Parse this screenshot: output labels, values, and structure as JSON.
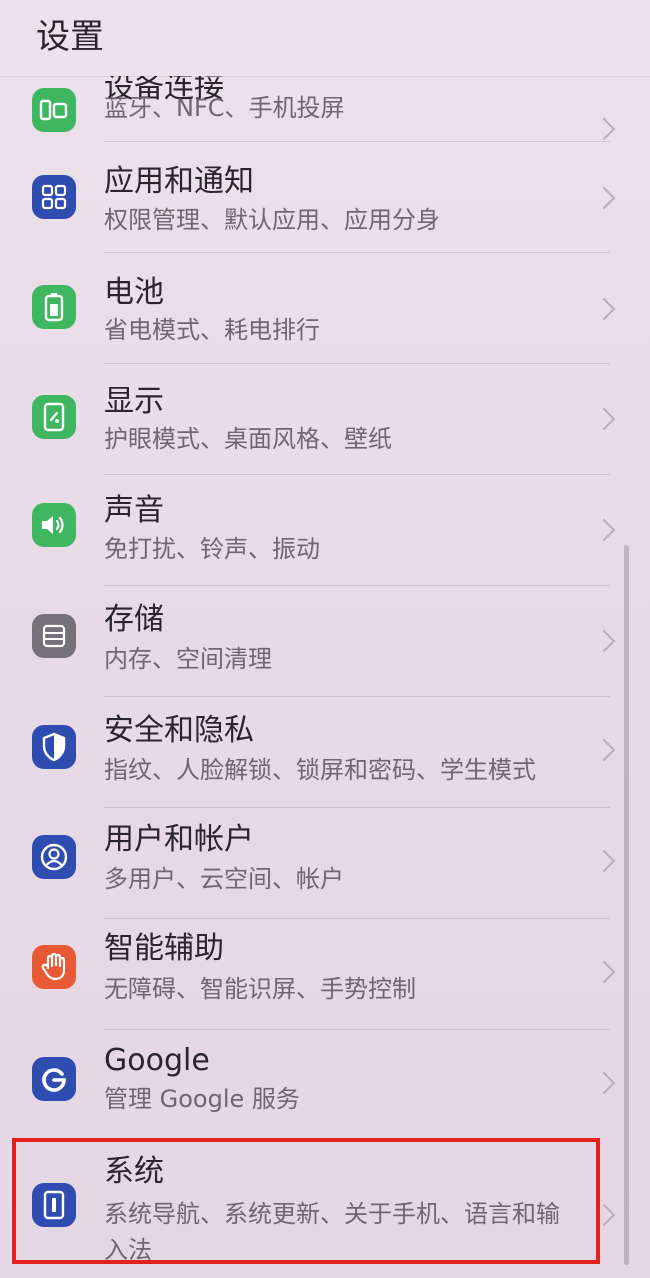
{
  "header": {
    "title": "设置"
  },
  "items": [
    {
      "key": "device-connection",
      "title": "设备连接",
      "subtitle": "蓝牙、NFC、手机投屏",
      "icon": "device-connection-icon",
      "icon_color": "#3fb660"
    },
    {
      "key": "apps",
      "title": "应用和通知",
      "subtitle": "权限管理、默认应用、应用分身",
      "icon": "apps-grid-icon",
      "icon_color": "#2f4db0"
    },
    {
      "key": "battery",
      "title": "电池",
      "subtitle": "省电模式、耗电排行",
      "icon": "battery-icon",
      "icon_color": "#3fb660"
    },
    {
      "key": "display",
      "title": "显示",
      "subtitle": "护眼模式、桌面风格、壁纸",
      "icon": "display-icon",
      "icon_color": "#3fb660"
    },
    {
      "key": "sound",
      "title": "声音",
      "subtitle": "免打扰、铃声、振动",
      "icon": "sound-icon",
      "icon_color": "#3fb660"
    },
    {
      "key": "storage",
      "title": "存储",
      "subtitle": "内存、空间清理",
      "icon": "storage-icon",
      "icon_color": "#76707a"
    },
    {
      "key": "security",
      "title": "安全和隐私",
      "subtitle": "指纹、人脸解锁、锁屏和密码、学生模式",
      "icon": "shield-icon",
      "icon_color": "#2f4db0"
    },
    {
      "key": "users",
      "title": "用户和帐户",
      "subtitle": "多用户、云空间、帐户",
      "icon": "user-icon",
      "icon_color": "#2f4db0"
    },
    {
      "key": "accessibility",
      "title": "智能辅助",
      "subtitle": "无障碍、智能识屏、手势控制",
      "icon": "hand-icon",
      "icon_color": "#e85a35"
    },
    {
      "key": "google",
      "title": "Google",
      "subtitle": "管理 Google 服务",
      "icon": "google-icon",
      "icon_color": "#2f4db0"
    },
    {
      "key": "system",
      "title": "系统",
      "subtitle": "系统导航、系统更新、关于手机、语言和输入法",
      "icon": "system-phone-icon",
      "icon_color": "#2f4db0"
    }
  ],
  "highlight_color": "#e3211b"
}
